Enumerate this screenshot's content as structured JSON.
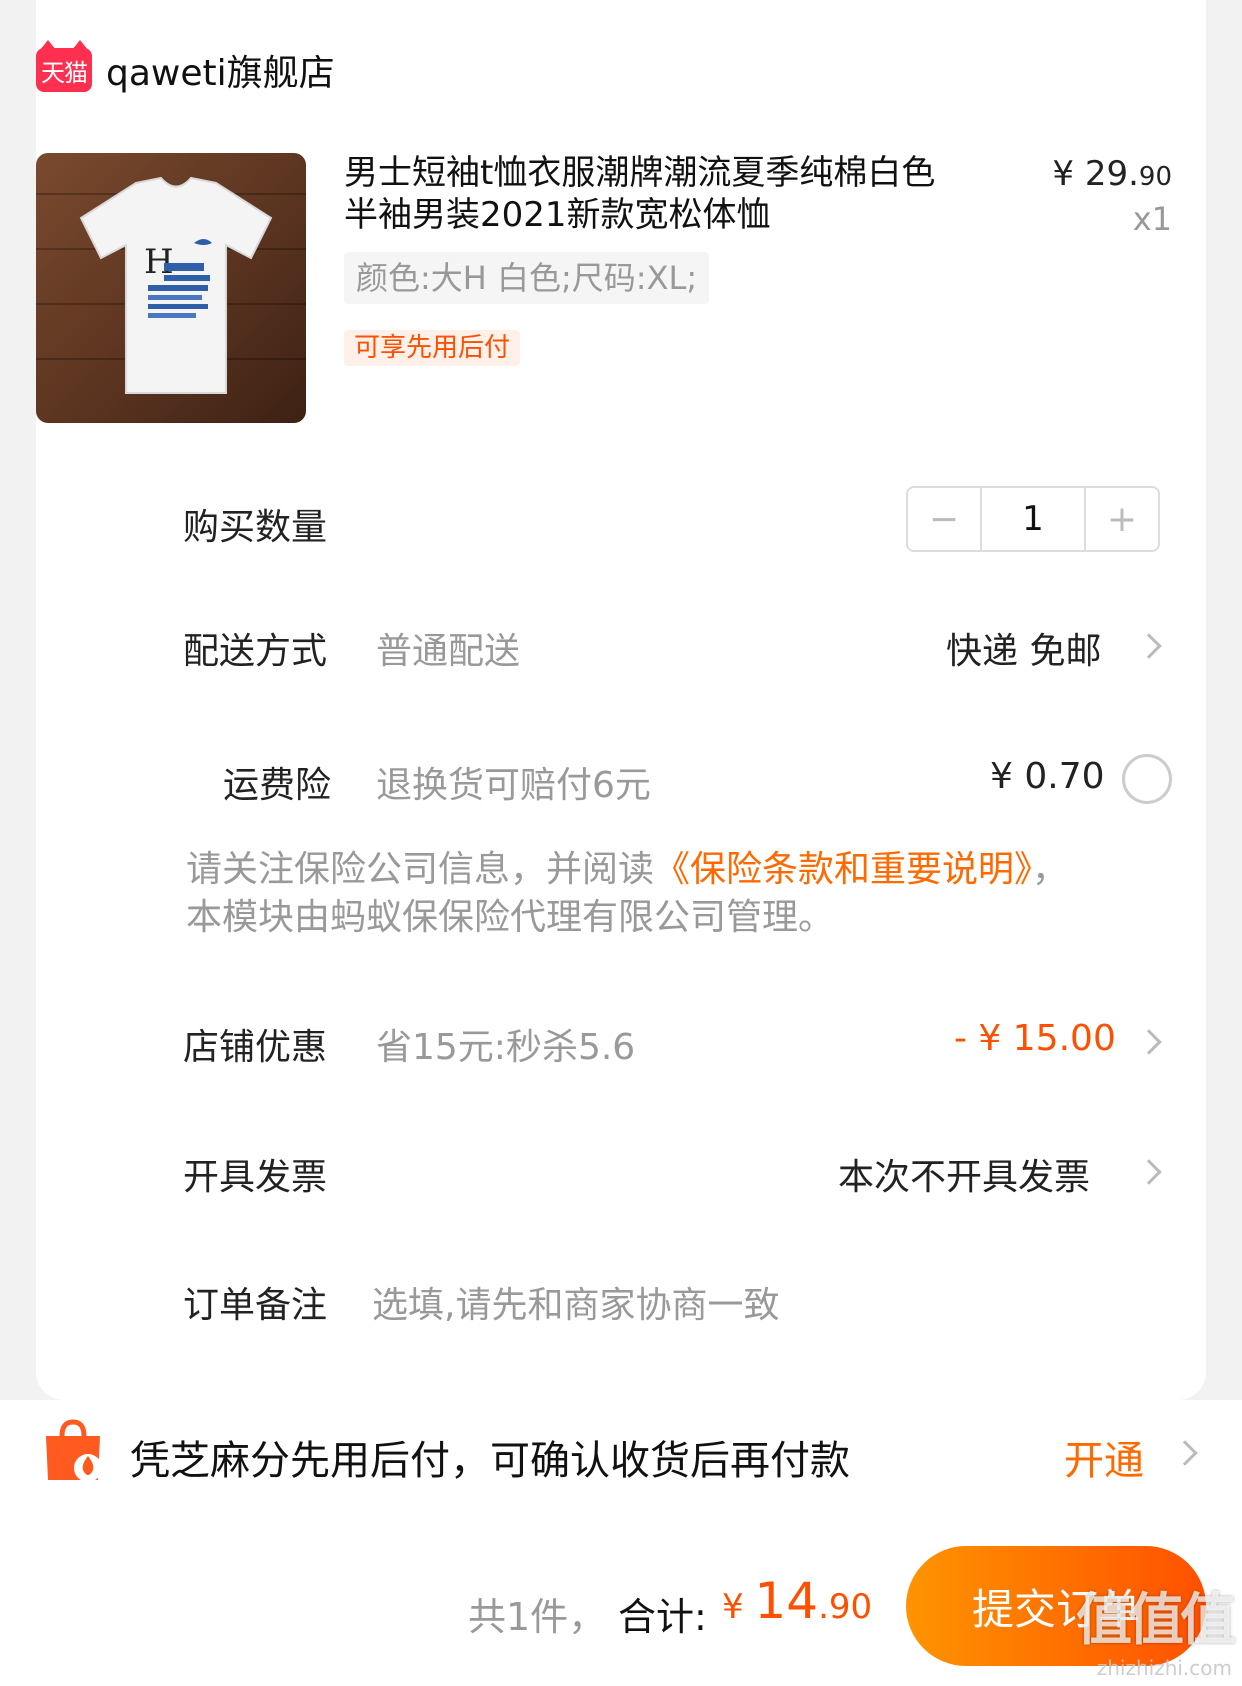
{
  "store": {
    "logo_text": "天猫",
    "name": "qaweti旗舰店"
  },
  "item": {
    "title": "男士短袖t恤衣服潮牌潮流夏季纯棉白色半袖男装2021新款宽松体恤",
    "price_main": "¥ 29.",
    "price_decimal": "90",
    "quantity_label": "x1",
    "spec": "颜色:大H 白色;尺码:XL;",
    "tag": "可享先用后付"
  },
  "rows": {
    "quantity": {
      "label": "购买数量",
      "value": "1",
      "minus": "−",
      "plus": "+"
    },
    "delivery": {
      "label": "配送方式",
      "sub": "普通配送",
      "value": "快递 免邮"
    },
    "insurance": {
      "label": "运费险",
      "sub": "退换货可赔付6元",
      "value": "¥ 0.70"
    },
    "insurance_notice": {
      "prefix": "请关注保险公司信息，并阅读",
      "link": "《保险条款和重要说明》",
      "suffix": "，本模块由蚂蚁保保险代理有限公司管理。"
    },
    "discount": {
      "label": "店铺优惠",
      "sub": "省15元:秒杀5.6",
      "value": "- ¥ 15.00"
    },
    "invoice": {
      "label": "开具发票",
      "value": "本次不开具发票"
    },
    "note": {
      "label": "订单备注",
      "placeholder": "选填,请先和商家协商一致"
    }
  },
  "banner": {
    "text": "凭芝麻分先用后付，可确认收货后再付款",
    "action": "开通"
  },
  "footer": {
    "count": "共1件，",
    "total_label": "合计:",
    "yen": "¥ ",
    "total_int": "14",
    "total_dec": ".90",
    "submit": "提交订单"
  },
  "watermark": {
    "big": "值值值",
    "small": "zhizhizhi.com"
  },
  "colors": {
    "accent": "#ff5000",
    "tmall_red": "#ff2f4f",
    "muted": "#999999"
  }
}
